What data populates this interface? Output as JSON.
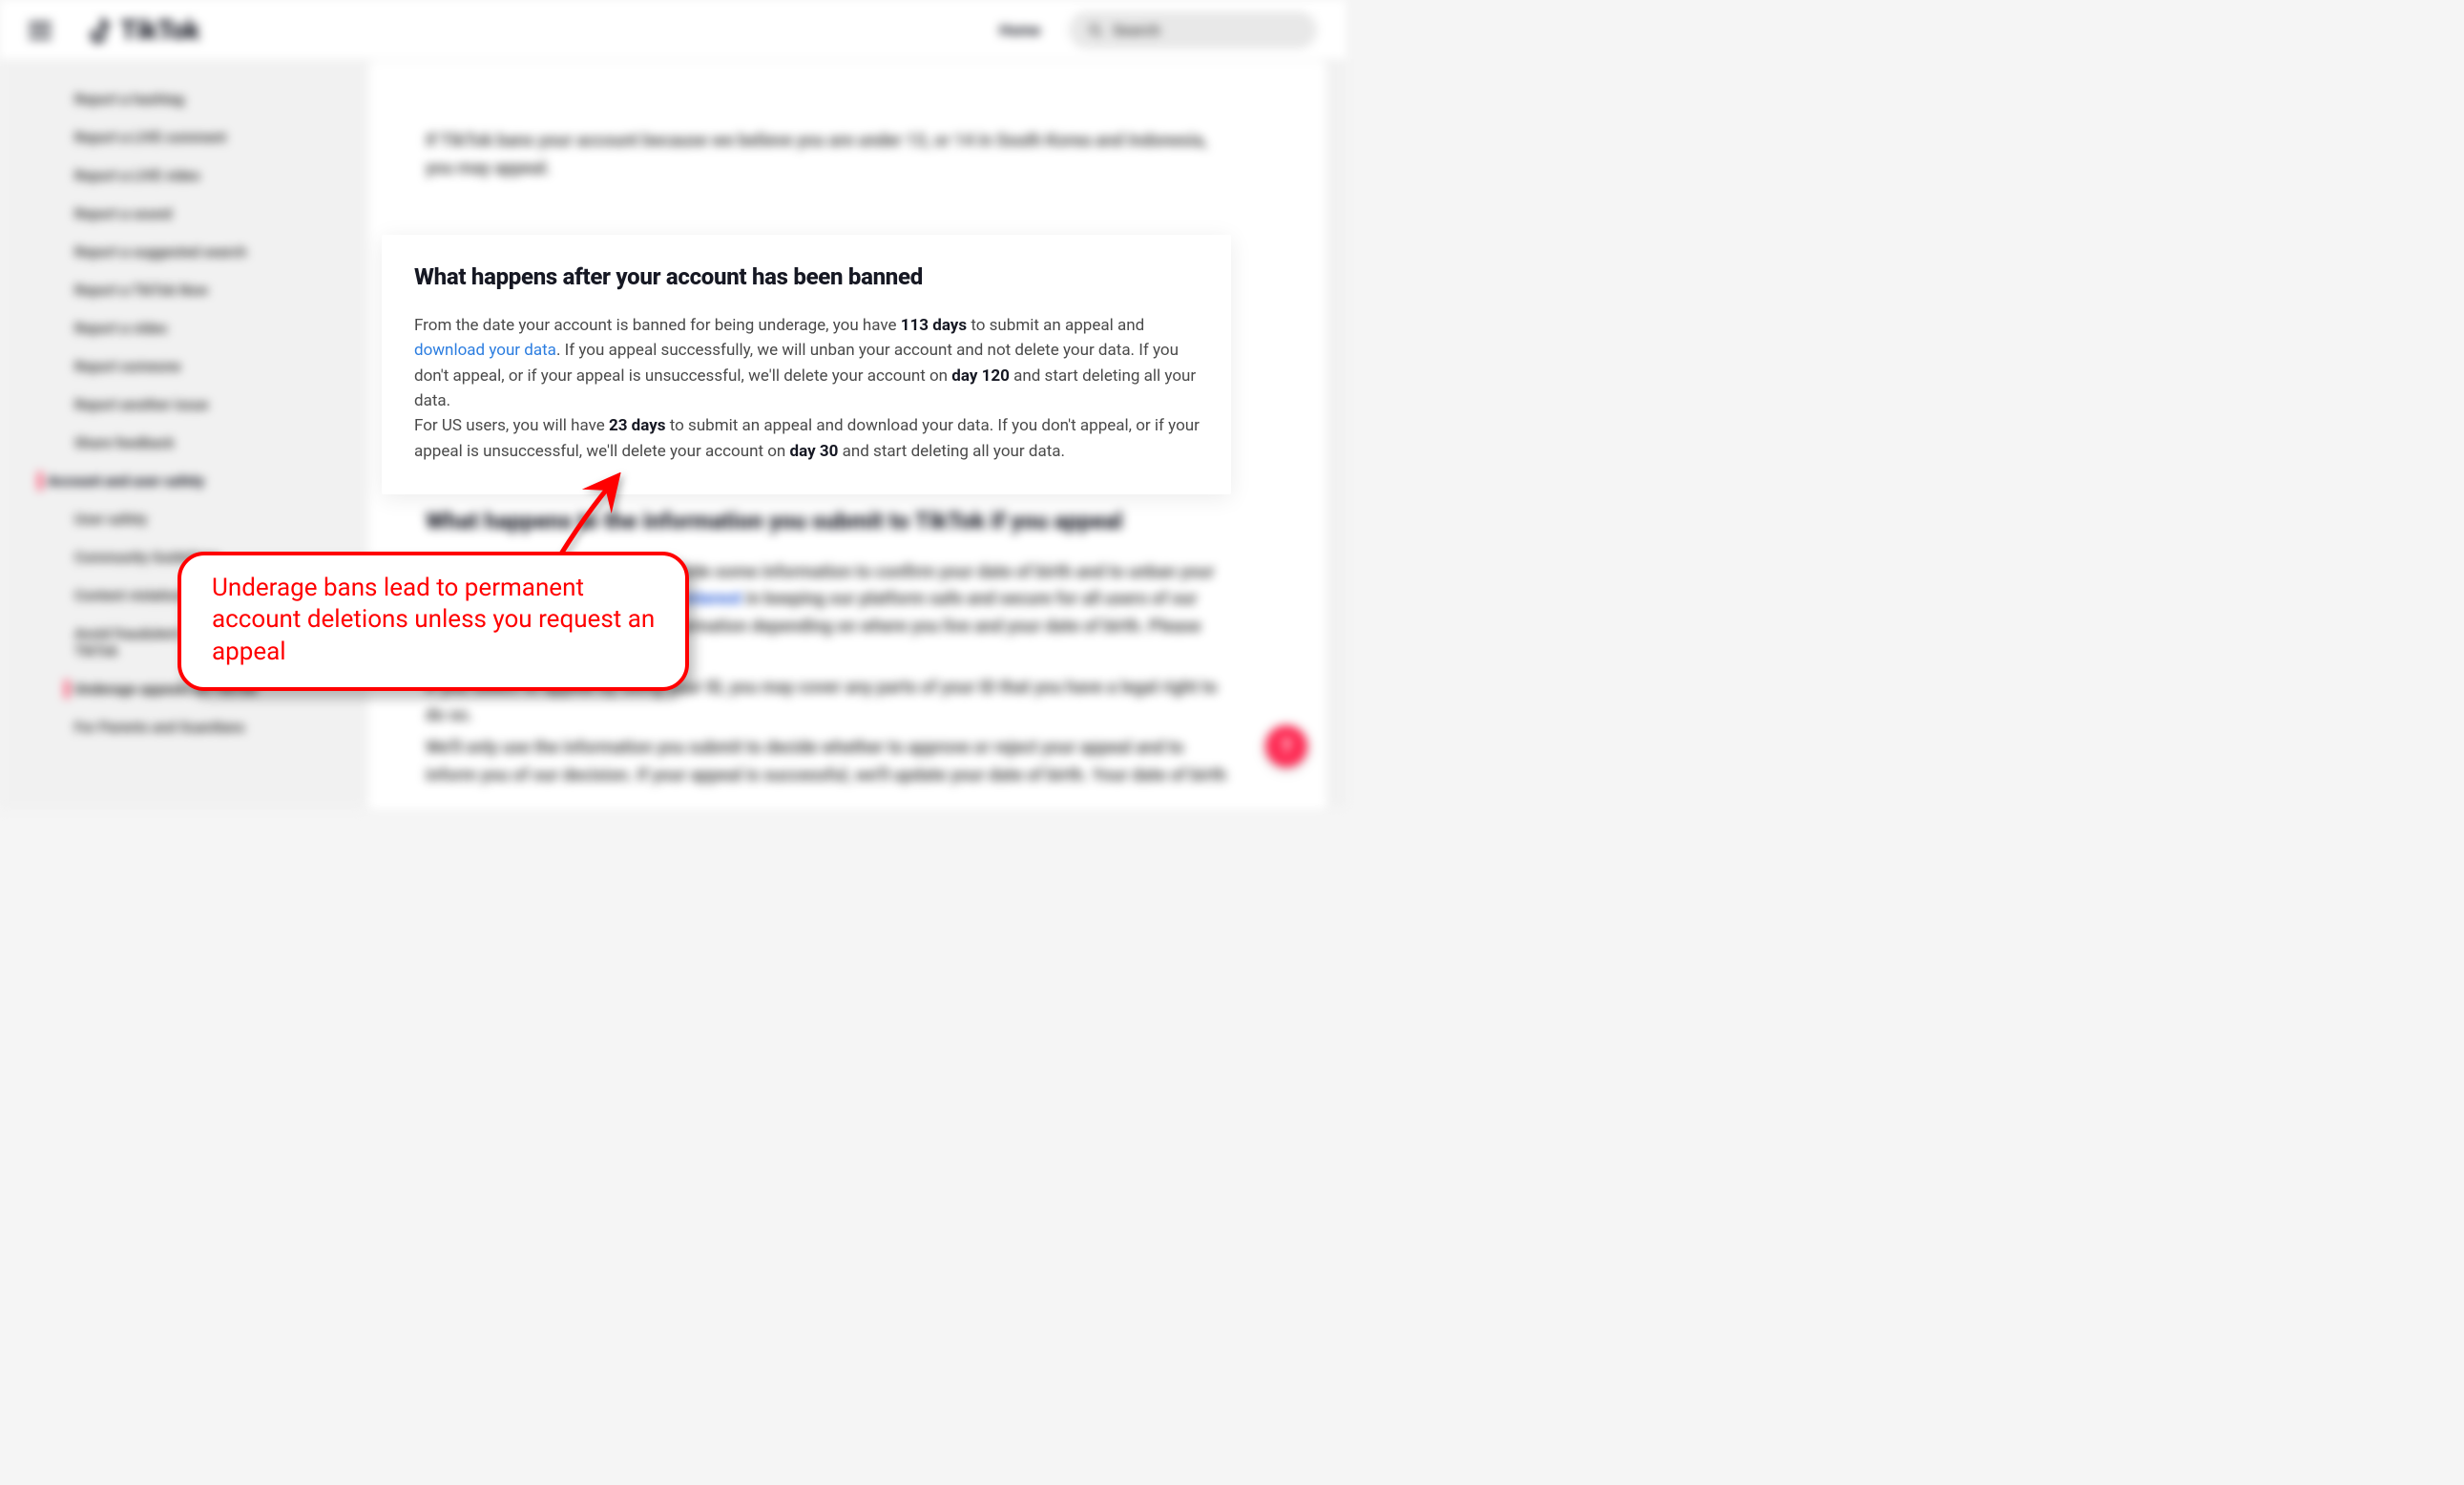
{
  "header": {
    "brand": "TikTok",
    "nav_home": "Home",
    "search_placeholder": "Search"
  },
  "sidebar": {
    "items": [
      {
        "label": "Report a hashtag",
        "level": "lvl1"
      },
      {
        "label": "Report a LIVE comment",
        "level": "lvl1"
      },
      {
        "label": "Report a LIVE video",
        "level": "lvl1"
      },
      {
        "label": "Report a sound",
        "level": "lvl1"
      },
      {
        "label": "Report a suggested search",
        "level": "lvl1"
      },
      {
        "label": "Report a TikTok Now",
        "level": "lvl1"
      },
      {
        "label": "Report a video",
        "level": "lvl1"
      },
      {
        "label": "Report someone",
        "level": "lvl1"
      },
      {
        "label": "Report another issue",
        "level": "lvl1"
      },
      {
        "label": "Share feedback",
        "level": "lvl1"
      },
      {
        "label": "Account and user safety",
        "level": "section",
        "active": true
      },
      {
        "label": "User safety",
        "level": "lvl1"
      },
      {
        "label": "Community Guidelines",
        "level": "lvl1"
      },
      {
        "label": "Content violations and bans",
        "level": "lvl1"
      },
      {
        "label": "Avoid fraudulent message attacks on TikTok",
        "level": "lvl1"
      },
      {
        "label": "Underage appeals on TikTok",
        "level": "lvl1",
        "active": true
      },
      {
        "label": "For Parents and Guardians",
        "level": "lvl1"
      }
    ]
  },
  "blurred_content": {
    "intro": "If TikTok bans your account because we believe you are under 13, or 14 in South Korea and Indonesia, you may appeal.",
    "section2_title": "What happens to the information you submit to TikTok if you appeal",
    "section2_p1_a": "If you appeal, we'll ask you to provide some information to confirm your date of birth and to unban your account (as we have a ",
    "section2_link": "legitimate interest",
    "section2_p1_b": " in keeping our platform safe and secure for all users of our services). We'll need different information depending on where you live and your date of birth. Please note that:",
    "section2_bullet1": "If you select to appeal by using your ID, you may cover any parts of your ID that you have a legal right to do so.",
    "section2_bullet2": "We'll only use the information you submit to decide whether to approve or reject your appeal and to inform you of our decision. If your appeal is successful, we'll update your date of birth. Your date of birth"
  },
  "highlight": {
    "title": "What happens after your account has been banned",
    "p1_a": "From the date your account is banned for being underage, you have ",
    "p1_days113": "113 days",
    "p1_b": " to submit an appeal and ",
    "p1_link": "download your data",
    "p1_c": ". If you appeal successfully, we will unban your account and not delete your data. If you don't appeal, or if your appeal is unsuccessful, we'll delete your account on ",
    "p1_day120": "day 120",
    "p1_d": " and start deleting all your data.",
    "p2_a": "For US users, you will have ",
    "p2_days23": "23 days",
    "p2_b": " to submit an appeal and download your data. If you don't appeal, or if your appeal is unsuccessful, we'll delete your account on ",
    "p2_day30": "day 30",
    "p2_c": " and start deleting all your data."
  },
  "callout": {
    "text": "Underage bans lead to permanent account deletions unless you request an appeal"
  },
  "fab": {
    "label": "?"
  }
}
